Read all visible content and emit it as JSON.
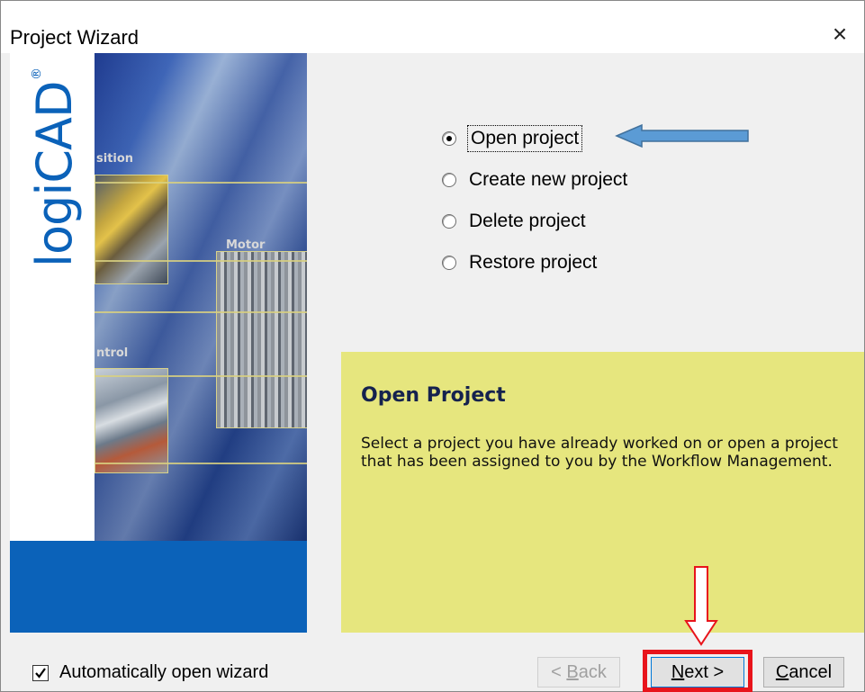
{
  "window": {
    "title": "Project Wizard",
    "close_symbol": "×"
  },
  "banner": {
    "logo_text": "logiCAD",
    "logo_mark": "®",
    "tags": [
      "sition",
      "Motor",
      "ntrol"
    ]
  },
  "options": [
    {
      "label": "Open project",
      "checked": true
    },
    {
      "label": "Create new project",
      "checked": false
    },
    {
      "label": "Delete project",
      "checked": false
    },
    {
      "label": "Restore project",
      "checked": false
    }
  ],
  "info": {
    "title": "Open Project",
    "text": "Select a project you have already worked on or open a project that has been assigned to you by the Workflow Management."
  },
  "footer": {
    "auto_open_label": "Automatically open wizard",
    "auto_open_checked": true,
    "back_pre": "< ",
    "back_mnemonic": "B",
    "back_post": "ack",
    "next_mnemonic": "N",
    "next_post": "ext >",
    "cancel_mnemonic": "C",
    "cancel_post": "ancel"
  },
  "colors": {
    "info_panel": "#e6e67e",
    "banner_blue": "#0b62b9",
    "annotation_arrow_blue": "#5b9bd5",
    "annotation_red": "#e8141b"
  }
}
